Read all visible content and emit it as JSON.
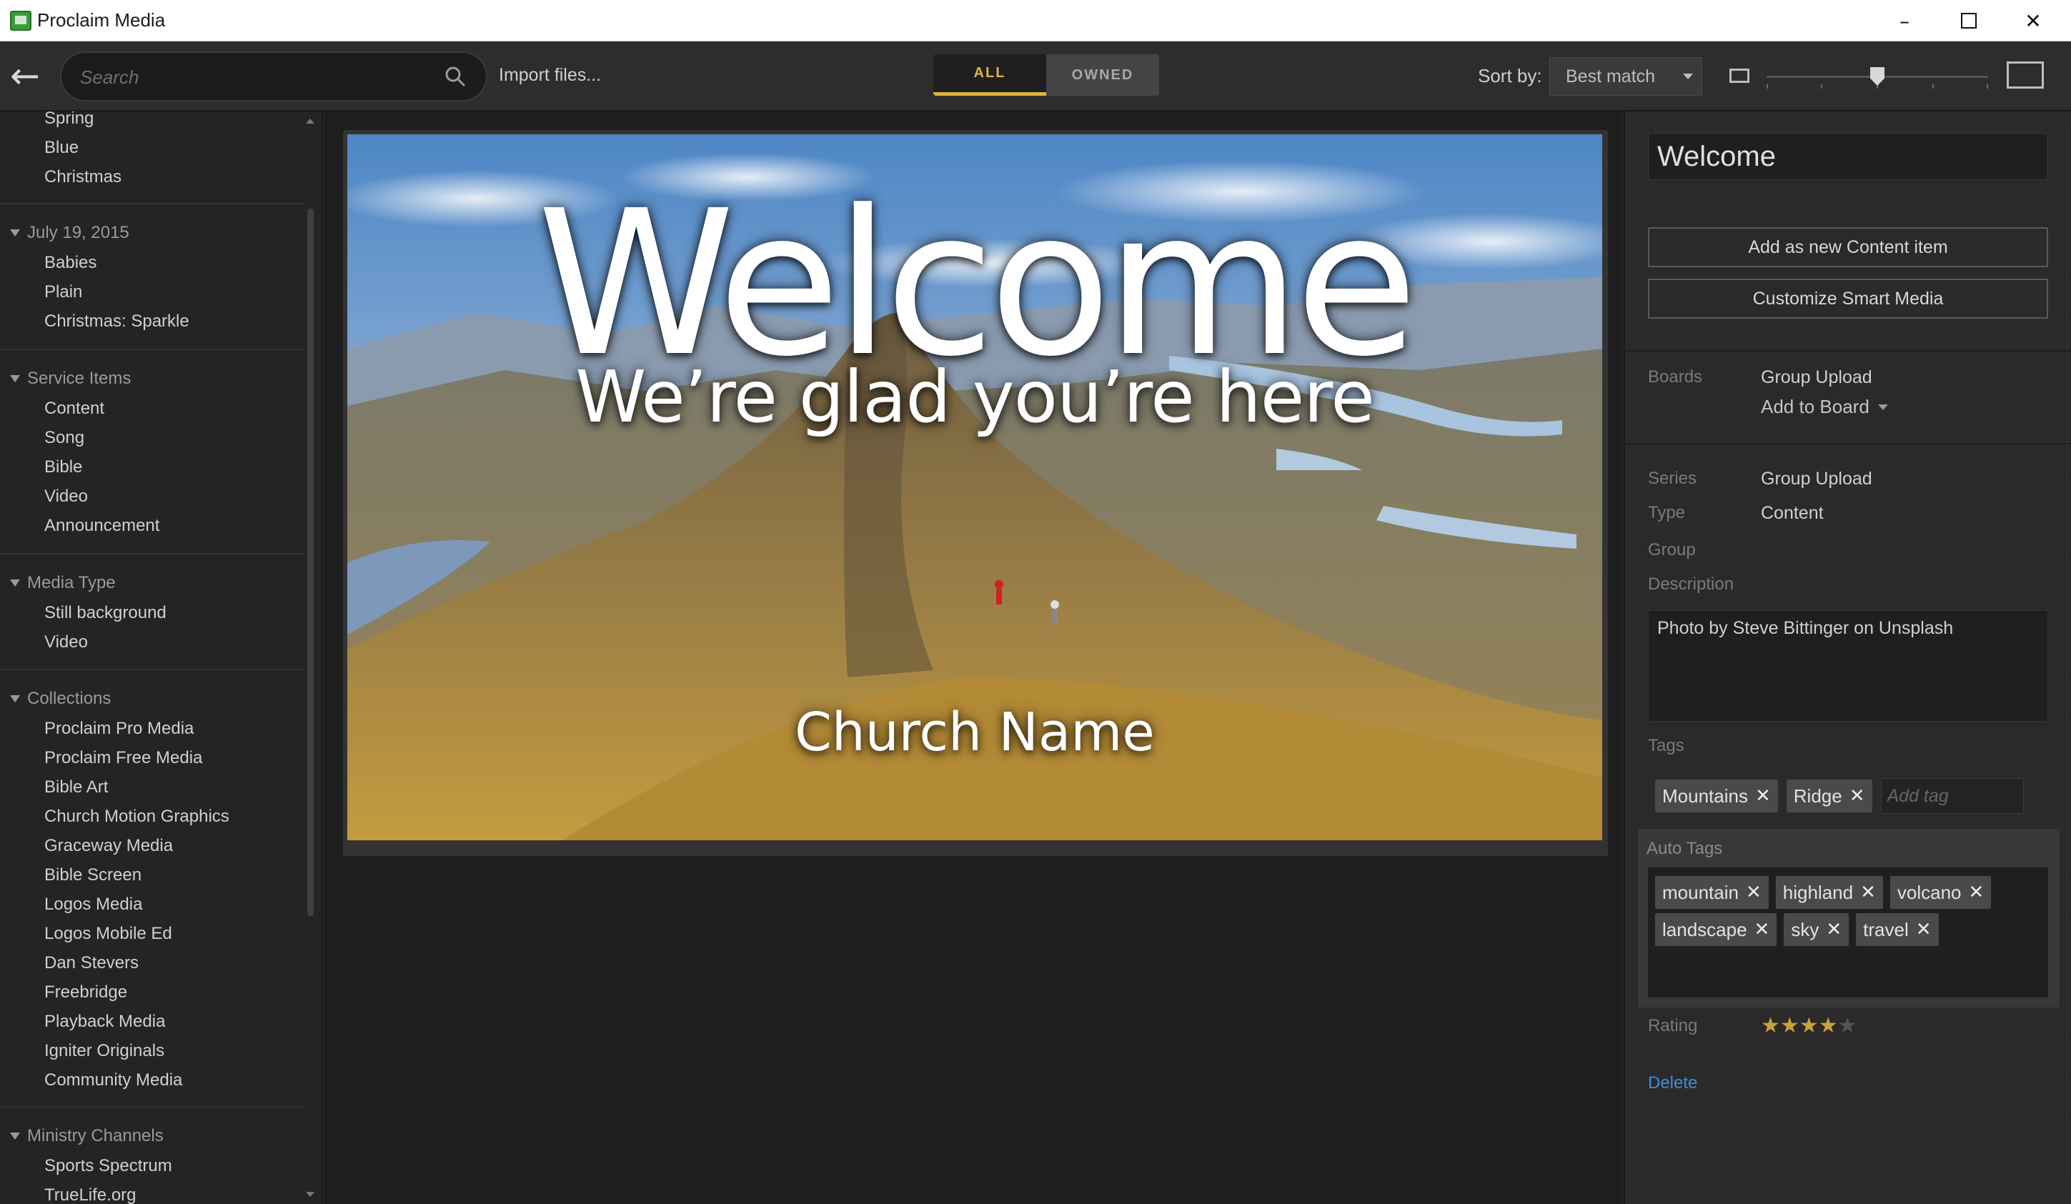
{
  "window": {
    "title": "Proclaim Media"
  },
  "toolbar": {
    "search_placeholder": "Search",
    "import_label": "Import files...",
    "filter_all": "ALL",
    "filter_owned": "OWNED",
    "sort_label": "Sort by:",
    "sort_value": "Best match",
    "thumb_size_level": 0.5
  },
  "sidebar": {
    "top_items": [
      "Spring",
      "Blue",
      "Christmas"
    ],
    "sections": [
      {
        "title": "July 19, 2015",
        "items": [
          "Babies",
          "Plain",
          "Christmas: Sparkle"
        ]
      },
      {
        "title": "Service Items",
        "items": [
          "Content",
          "Song",
          "Bible",
          "Video",
          "Announcement"
        ]
      },
      {
        "title": "Media Type",
        "items": [
          "Still background",
          "Video"
        ]
      },
      {
        "title": "Collections",
        "items": [
          "Proclaim Pro Media",
          "Proclaim Free Media",
          "Bible Art",
          "Church Motion Graphics",
          "Graceway Media",
          "Bible Screen",
          "Logos Media",
          "Logos Mobile Ed",
          "Dan Stevers",
          "Freebridge",
          "Playback Media",
          "Igniter Originals",
          "Community Media"
        ]
      },
      {
        "title": "Ministry Channels",
        "items": [
          "Sports Spectrum",
          "TrueLife.org"
        ]
      }
    ]
  },
  "preview": {
    "title": "Welcome",
    "subtitle": "We’re glad you’re here",
    "footer": "Church Name"
  },
  "details": {
    "title_value": "Welcome",
    "add_content_label": "Add as new Content item",
    "customize_label": "Customize Smart Media",
    "boards_label": "Boards",
    "boards_value": "Group Upload",
    "add_board_label": "Add to Board",
    "series_label": "Series",
    "series_value": "Group Upload",
    "type_label": "Type",
    "type_value": "Content",
    "group_label": "Group",
    "description_label": "Description",
    "description_value": "Photo by Steve Bittinger on Unsplash",
    "tags_label": "Tags",
    "tags": [
      "Mountains",
      "Ridge"
    ],
    "add_tag_placeholder": "Add tag",
    "auto_tags_label": "Auto Tags",
    "auto_tags_row1": [
      "mountain",
      "highland",
      "volcano"
    ],
    "auto_tags_row2": [
      "landscape",
      "sky",
      "travel"
    ],
    "rating_label": "Rating",
    "rating_value": 4,
    "rating_max": 5,
    "delete_label": "Delete"
  },
  "colors": {
    "accent": "#e3b43e",
    "link": "#3a8fd8",
    "star": "#c9a13a"
  },
  "icons": [
    "app-icon",
    "back-arrow-icon",
    "search-icon",
    "minimize-icon",
    "maximize-icon",
    "close-icon",
    "small-thumb-icon",
    "large-thumb-icon",
    "collapse-triangle-icon",
    "remove-tag-icon",
    "star-icon"
  ]
}
